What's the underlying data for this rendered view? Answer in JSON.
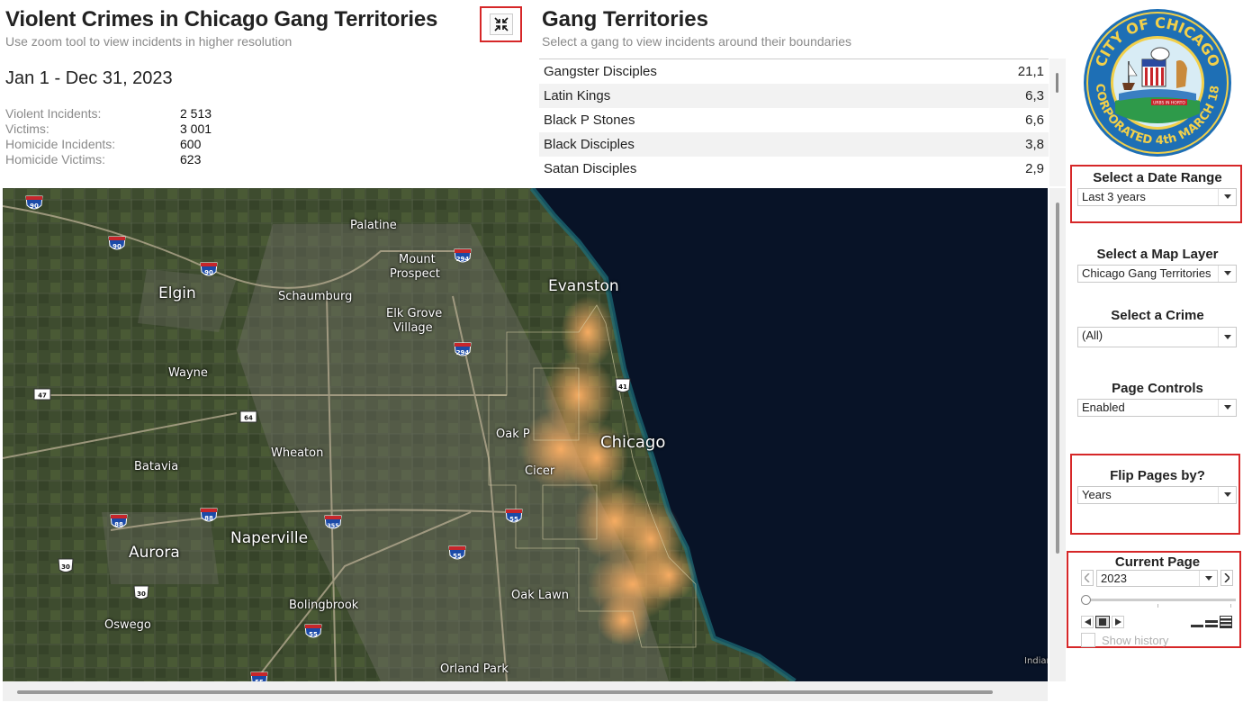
{
  "header": {
    "title": "Violent Crimes in Chicago Gang Territories",
    "subtitle": "Use zoom tool to view incidents in higher resolution",
    "date_range": "Jan 1 - Dec 31, 2023",
    "stats": [
      {
        "label": "Violent Incidents:",
        "value": "2 513"
      },
      {
        "label": "Victims:",
        "value": "3 001"
      },
      {
        "label": "Homicide Incidents:",
        "value": "600"
      },
      {
        "label": "Homicide Victims:",
        "value": "623"
      }
    ],
    "collapse_icon": "collapse-arrows-icon"
  },
  "gangs": {
    "title": "Gang Territories",
    "subtitle": "Select a gang to view incidents around their boundaries",
    "rows": [
      {
        "name": "Gangster Disciples",
        "value": "21,1"
      },
      {
        "name": "Latin Kings",
        "value": "6,3"
      },
      {
        "name": "Black P Stones",
        "value": "6,6"
      },
      {
        "name": "Black Disciples",
        "value": "3,8"
      },
      {
        "name": "Satan Disciples",
        "value": "2,9"
      }
    ]
  },
  "seal": {
    "top_text": "CITY OF CHICAGO",
    "bottom_text": "INCORPORATED 4th MARCH 1837",
    "motto": "URBS IN HORTO"
  },
  "map": {
    "places": [
      {
        "name": "Palatine",
        "size": "mid"
      },
      {
        "name": "Mount",
        "size": "mid"
      },
      {
        "name": "Prospect",
        "size": "mid"
      },
      {
        "name": "Evanston",
        "size": "big"
      },
      {
        "name": "Elgin",
        "size": "big"
      },
      {
        "name": "Schaumburg",
        "size": "mid"
      },
      {
        "name": "Elk Grove",
        "size": "mid"
      },
      {
        "name": "Village",
        "size": "mid"
      },
      {
        "name": "Wayne",
        "size": "mid"
      },
      {
        "name": "Oak P",
        "size": "mid"
      },
      {
        "name": "Chicago",
        "size": "city"
      },
      {
        "name": "Wheaton",
        "size": "mid"
      },
      {
        "name": "Batavia",
        "size": "mid"
      },
      {
        "name": "Cicer",
        "size": "mid"
      },
      {
        "name": "Aurora",
        "size": "big"
      },
      {
        "name": "Naperville",
        "size": "big"
      },
      {
        "name": "Oak Lawn",
        "size": "mid"
      },
      {
        "name": "Bolingbrook",
        "size": "mid"
      },
      {
        "name": "Oswego",
        "size": "mid"
      },
      {
        "name": "Orland Park",
        "size": "mid"
      },
      {
        "name": "Indiana",
        "size": "mid"
      }
    ],
    "shields": [
      {
        "label": "90",
        "type": "interstate"
      },
      {
        "label": "90",
        "type": "interstate"
      },
      {
        "label": "90",
        "type": "interstate"
      },
      {
        "label": "294",
        "type": "interstate"
      },
      {
        "label": "294",
        "type": "interstate"
      },
      {
        "label": "41",
        "type": "us"
      },
      {
        "label": "47",
        "type": "state"
      },
      {
        "label": "64",
        "type": "state"
      },
      {
        "label": "88",
        "type": "interstate"
      },
      {
        "label": "88",
        "type": "interstate"
      },
      {
        "label": "355",
        "type": "interstate"
      },
      {
        "label": "55",
        "type": "interstate"
      },
      {
        "label": "55",
        "type": "interstate"
      },
      {
        "label": "55",
        "type": "interstate"
      },
      {
        "label": "30",
        "type": "us"
      },
      {
        "label": "30",
        "type": "us"
      },
      {
        "label": "55",
        "type": "interstate"
      }
    ]
  },
  "controls": {
    "date_range": {
      "title": "Select a Date Range",
      "value": "Last 3 years"
    },
    "map_layer": {
      "title": "Select a Map Layer",
      "value": "Chicago Gang Territories"
    },
    "crime": {
      "title": "Select a Crime",
      "value": "(All)"
    },
    "page_controls": {
      "title": "Page Controls",
      "value": "Enabled"
    },
    "flip": {
      "title": "Flip Pages by?",
      "value": "Years"
    },
    "current_page": {
      "title": "Current Page",
      "value": "2023",
      "slider_fraction": 0
    },
    "show_history": "Show history",
    "accent": "#d62728"
  }
}
